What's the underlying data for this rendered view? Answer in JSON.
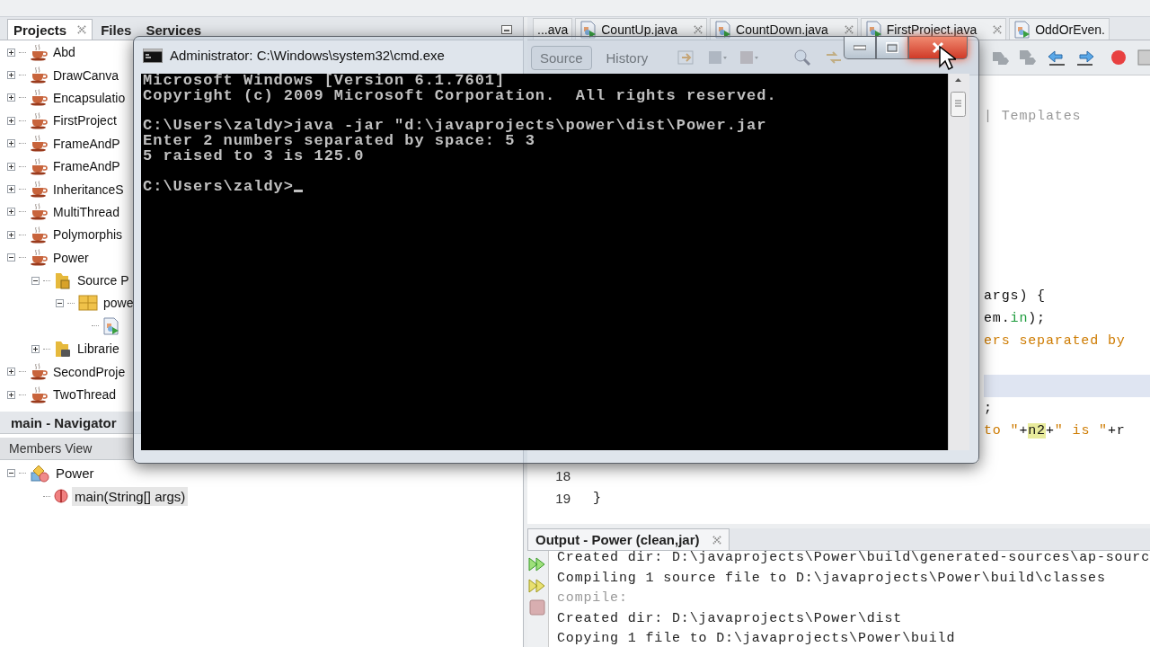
{
  "projects_panel": {
    "tabs": [
      {
        "label": "Projects",
        "selected": true,
        "closable": true
      },
      {
        "label": "Files",
        "selected": false,
        "closable": false
      },
      {
        "label": "Services",
        "selected": false,
        "closable": false
      }
    ],
    "tree": [
      {
        "label": "Abd",
        "kind": "project",
        "expanded": false
      },
      {
        "label": "DrawCanva",
        "kind": "project",
        "expanded": false
      },
      {
        "label": "Encapsulatio",
        "kind": "project",
        "expanded": false
      },
      {
        "label": "FirstProject",
        "kind": "project",
        "expanded": false
      },
      {
        "label": "FrameAndP",
        "kind": "project",
        "expanded": false
      },
      {
        "label": "FrameAndP",
        "kind": "project",
        "expanded": false
      },
      {
        "label": "InheritanceS",
        "kind": "project",
        "expanded": false
      },
      {
        "label": "MultiThread",
        "kind": "project",
        "expanded": false
      },
      {
        "label": "Polymorphis",
        "kind": "project",
        "expanded": false
      },
      {
        "label": "Power",
        "kind": "project",
        "expanded": true,
        "children": [
          {
            "label": "Source P",
            "kind": "source-folder",
            "expanded": true,
            "children": [
              {
                "label": "powe",
                "kind": "package",
                "expanded": true,
                "children": [
                  {
                    "kind": "java-file"
                  }
                ]
              }
            ]
          },
          {
            "label": "Librarie",
            "kind": "libraries",
            "expanded": false
          }
        ]
      },
      {
        "label": "SecondProje",
        "kind": "project",
        "expanded": false
      },
      {
        "label": "TwoThread",
        "kind": "project",
        "expanded": false
      }
    ]
  },
  "navigator": {
    "title": "main - Navigator",
    "view": "Members View",
    "tree": [
      {
        "label": "Power",
        "kind": "class",
        "expanded": true,
        "selected": false,
        "children": [
          {
            "label": "main(String[] args)",
            "kind": "method",
            "selected": true
          }
        ]
      }
    ]
  },
  "editor": {
    "tabs": [
      {
        "label": "...ava",
        "selected": false,
        "closable": false
      },
      {
        "label": "CountUp.java",
        "selected": false,
        "closable": true
      },
      {
        "label": "CountDown.java",
        "selected": false,
        "closable": true
      },
      {
        "label": "FirstProject.java",
        "selected": false,
        "closable": true
      },
      {
        "label": "OddOrEven.",
        "selected": false,
        "closable": false
      }
    ],
    "views": [
      {
        "label": "Source",
        "selected": true
      },
      {
        "label": "History",
        "selected": false
      }
    ],
    "lines": [
      {
        "current": false,
        "segments": [
          {
            "text": "| Templates",
            "kind": "comment"
          }
        ]
      },
      {
        "current": false
      },
      {
        "current": false
      },
      {
        "current": false
      },
      {
        "current": false
      },
      {
        "current": false
      },
      {
        "current": false
      },
      {
        "current": false
      },
      {
        "current": false,
        "segments": [
          {
            "text": "args) {",
            "kind": "plain"
          }
        ]
      },
      {
        "current": false,
        "segments": [
          {
            "text": "em.",
            "kind": "plain"
          },
          {
            "text": "in",
            "kind": "field"
          },
          {
            "text": ");",
            "kind": "plain"
          }
        ]
      },
      {
        "current": false,
        "segments": [
          {
            "text": "ers separated by",
            "kind": "string"
          }
        ]
      },
      {
        "current": false
      },
      {
        "current": true
      },
      {
        "current": false,
        "segments": [
          {
            "text": ";",
            "kind": "plain"
          }
        ]
      },
      {
        "current": false,
        "segments": [
          {
            "text": "to \"",
            "kind": "string"
          },
          {
            "text": "+",
            "kind": "plain"
          },
          {
            "text": "n2",
            "kind": "occurrence"
          },
          {
            "text": "+",
            "kind": "plain"
          },
          {
            "text": "\" is \"",
            "kind": "string"
          },
          {
            "text": "+r",
            "kind": "plain"
          }
        ]
      },
      {
        "current": false
      },
      {
        "current": false,
        "number": "18"
      },
      {
        "current": false,
        "number": "19",
        "segments": [
          {
            "text": "}",
            "kind": "plain"
          }
        ]
      }
    ]
  },
  "output": {
    "title": "Output - Power (clean,jar)",
    "lines": [
      {
        "text": "Created dir: D:\\javaprojects\\Power\\build\\generated-sources\\ap-sourc",
        "kind": "message"
      },
      {
        "text": "Compiling 1 source file to D:\\javaprojects\\Power\\build\\classes",
        "kind": "message"
      },
      {
        "text": "compile:",
        "kind": "target"
      },
      {
        "text": "Created dir: D:\\javaprojects\\Power\\dist",
        "kind": "message"
      },
      {
        "text": "Copying 1 file to D:\\javaprojects\\Power\\build",
        "kind": "message"
      }
    ]
  },
  "cmd": {
    "title": "Administrator: C:\\Windows\\system32\\cmd.exe",
    "close_hovered": true,
    "cursor_visible": true,
    "blocks": [
      [
        "Microsoft Windows [Version 6.1.7601]",
        "Copyright (c) 2009 Microsoft Corporation.  All rights reserved."
      ],
      [
        "C:\\Users\\zaldy>java -jar \"d:\\javaprojects\\power\\dist\\Power.jar",
        "Enter 2 numbers separated by space: 5 3",
        "5 raised to 3 is 125.0"
      ],
      [
        "C:\\Users\\zaldy>"
      ]
    ]
  }
}
